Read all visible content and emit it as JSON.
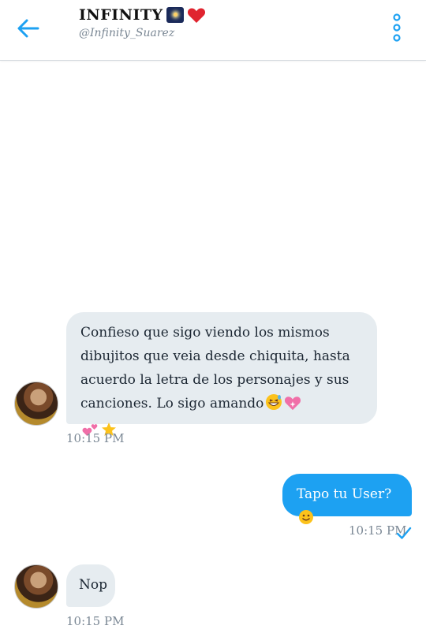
{
  "header": {
    "title": "INFINITY",
    "handle": "@Infinity_Suarez",
    "icons": [
      "back-arrow-icon",
      "fireworks-emoji-icon",
      "red-heart-emoji-icon",
      "more-vertical-icon"
    ]
  },
  "colors": {
    "accent": "#1da1f2",
    "incoming_bubble": "#e6ecf0",
    "timestamp": "#7a8794"
  },
  "messages": [
    {
      "direction": "incoming",
      "text": "Confieso que sigo viendo los mismos dibujitos que veia desde chiquita, hasta  acuerdo la letra de los personajes y sus canciones. Lo sigo amando",
      "trailing_emojis": [
        "grinning-sweat-emoji",
        "sparkling-heart-emoji",
        "two-hearts-emoji",
        "star-emoji"
      ],
      "time": "10:15 PM"
    },
    {
      "direction": "outgoing",
      "text": "Tapo tu User?",
      "trailing_emojis": [
        "smiling-face-emoji"
      ],
      "time": "10:15 PM",
      "status": "sent-check"
    },
    {
      "direction": "incoming",
      "text": "Nop",
      "time": "10:15 PM"
    }
  ]
}
